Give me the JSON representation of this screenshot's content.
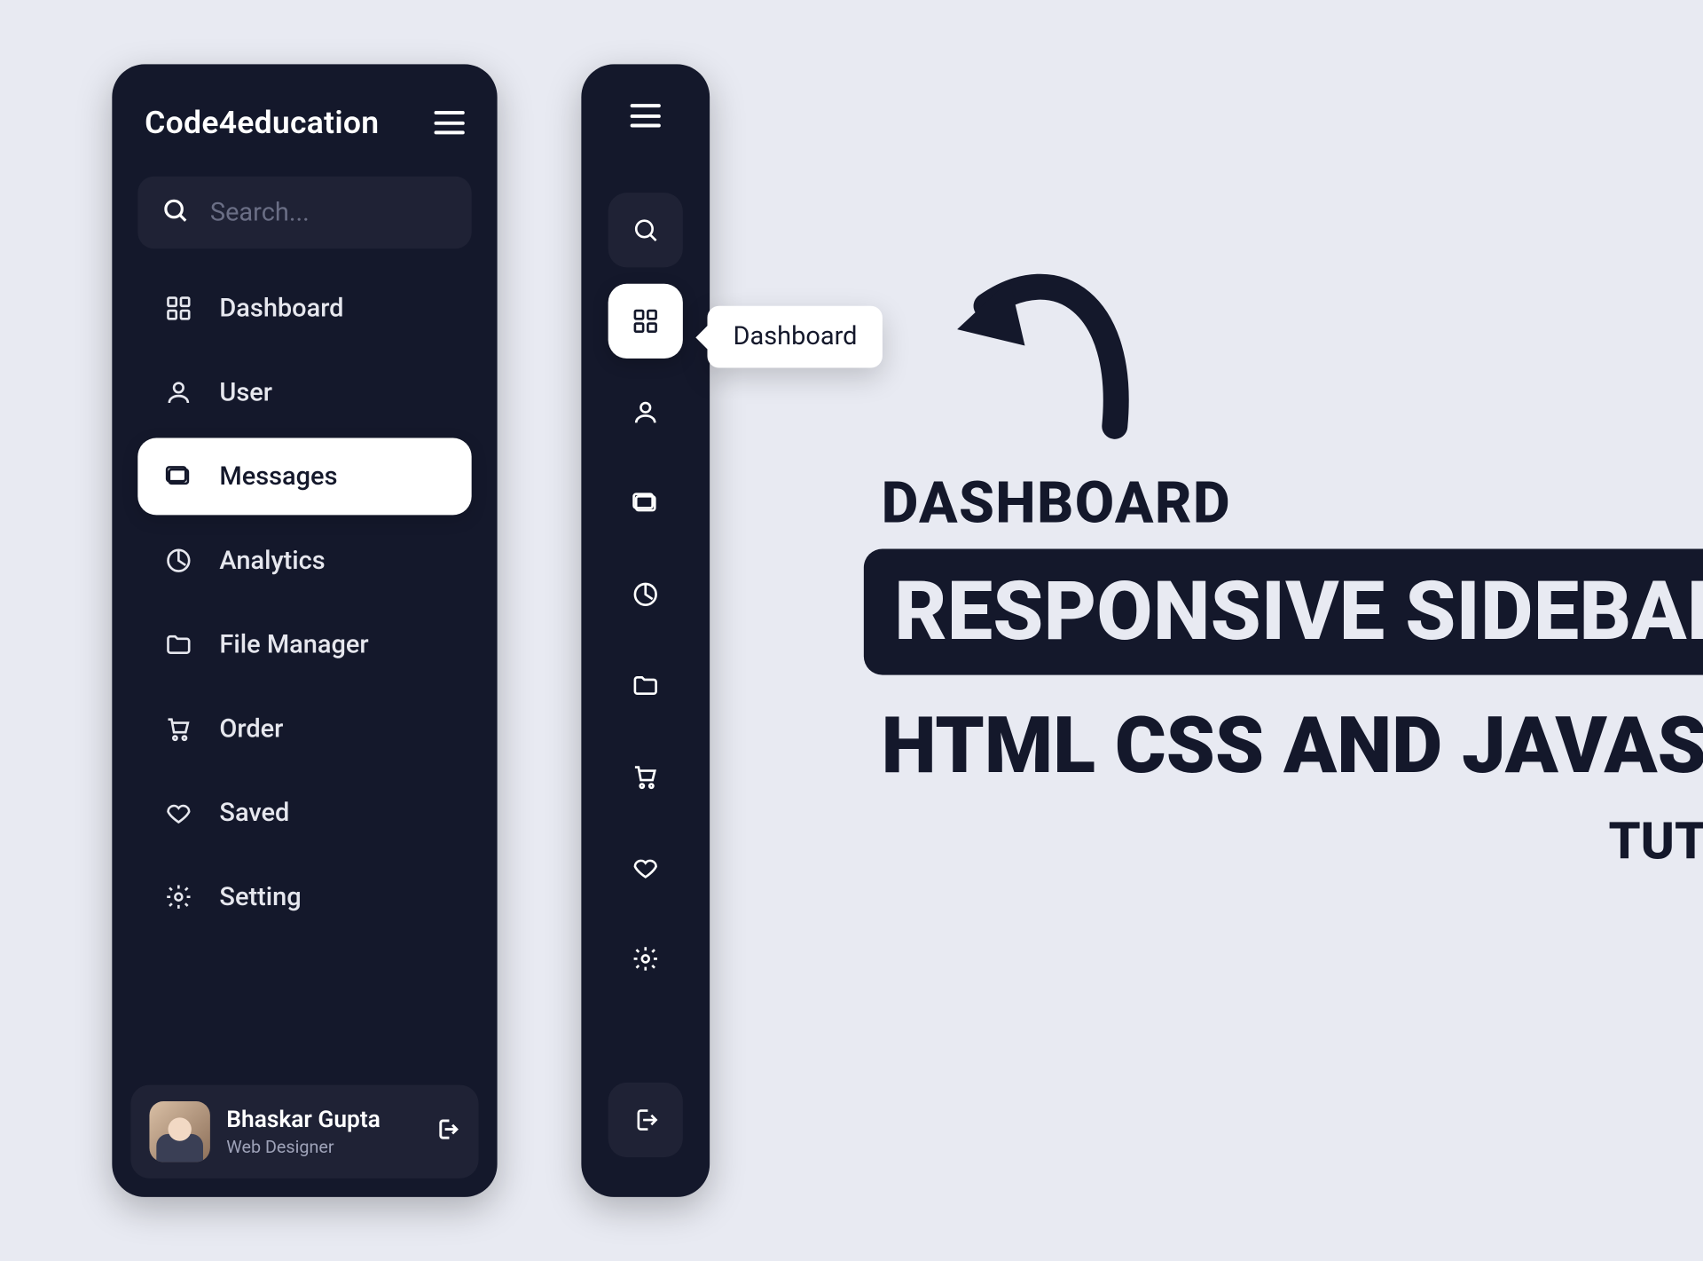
{
  "brand": "Code4education",
  "search": {
    "placeholder": "Search..."
  },
  "nav": {
    "items": {
      "dashboard": "Dashboard",
      "user": "User",
      "messages": "Messages",
      "analytics": "Analytics",
      "file_manager": "File Manager",
      "order": "Order",
      "saved": "Saved",
      "setting": "Setting"
    }
  },
  "tooltip": "Dashboard",
  "profile": {
    "name": "Bhaskar Gupta",
    "role": "Web Designer"
  },
  "headline": {
    "kicker": "DASHBOARD",
    "title": "RESPONSIVE SIDEBAR MENU",
    "tech": "HTML CSS AND JAVASCRIPT",
    "hindi": "TUTORIAL IN HINDI"
  },
  "colors": {
    "bg": "#e8eaf2",
    "panel": "#14182b",
    "panel_soft": "#1f2235"
  }
}
